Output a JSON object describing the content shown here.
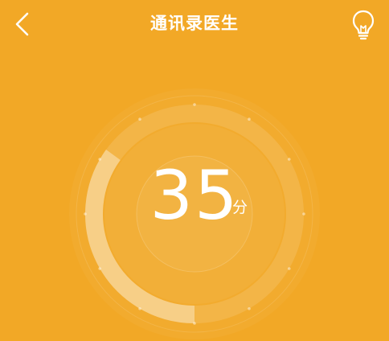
{
  "header": {
    "title": "通讯录医生",
    "back_icon": "chevron-left-icon",
    "tips_icon": "lightbulb-icon"
  },
  "score": {
    "value": "35",
    "unit": "分",
    "progress_fraction": 0.35
  },
  "colors": {
    "background": "#F2A826",
    "foreground": "#FFFFFF"
  }
}
